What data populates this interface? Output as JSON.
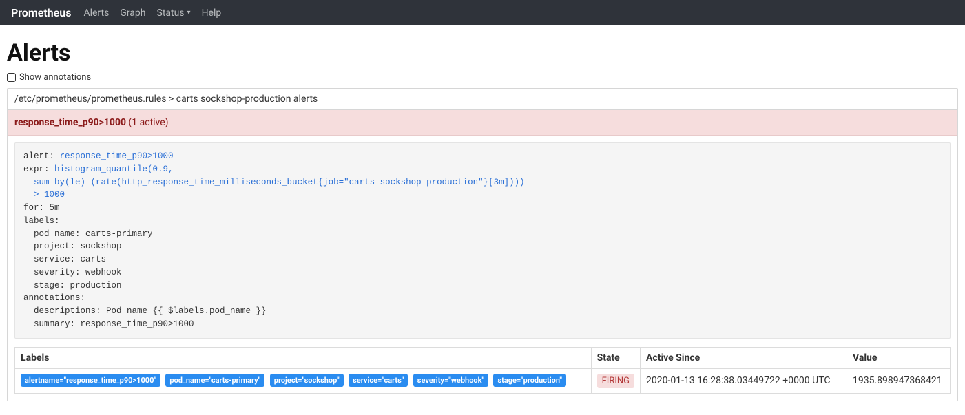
{
  "navbar": {
    "brand": "Prometheus",
    "links": {
      "alerts": "Alerts",
      "graph": "Graph",
      "status": "Status",
      "help": "Help"
    }
  },
  "page": {
    "title": "Alerts",
    "show_annotations_label": "Show annotations"
  },
  "rule_group": {
    "path": "/etc/prometheus/prometheus.rules > carts sockshop-production alerts",
    "alert": {
      "name": "response_time_p90>1000",
      "active_count": "(1 active)",
      "definition": {
        "alert_prefix": "alert: ",
        "alert_name": "response_time_p90>1000",
        "expr_prefix": "expr: ",
        "expr_fn": "histogram_quantile(0.9,",
        "expr_body": "  sum by(le) (rate(http_response_time_milliseconds_bucket{job=\"carts-sockshop-production\"}[3m])))",
        "expr_cmp": "  > 1000",
        "for_line": "for: 5m",
        "labels_line": "labels:",
        "label_pod": "  pod_name: carts-primary",
        "label_project": "  project: sockshop",
        "label_service": "  service: carts",
        "label_severity": "  severity: webhook",
        "label_stage": "  stage: production",
        "annot_line": "annotations:",
        "annot_desc": "  descriptions: Pod name {{ $labels.pod_name }}",
        "annot_summary": "  summary: response_time_p90>1000"
      },
      "table": {
        "headers": {
          "labels": "Labels",
          "state": "State",
          "since": "Active Since",
          "value": "Value"
        },
        "row": {
          "labels": [
            "alertname=\"response_time_p90>1000\"",
            "pod_name=\"carts-primary\"",
            "project=\"sockshop\"",
            "service=\"carts\"",
            "severity=\"webhook\"",
            "stage=\"production\""
          ],
          "state": "FIRING",
          "since": "2020-01-13 16:28:38.03449722 +0000 UTC",
          "value": "1935.898947368421"
        }
      }
    }
  }
}
